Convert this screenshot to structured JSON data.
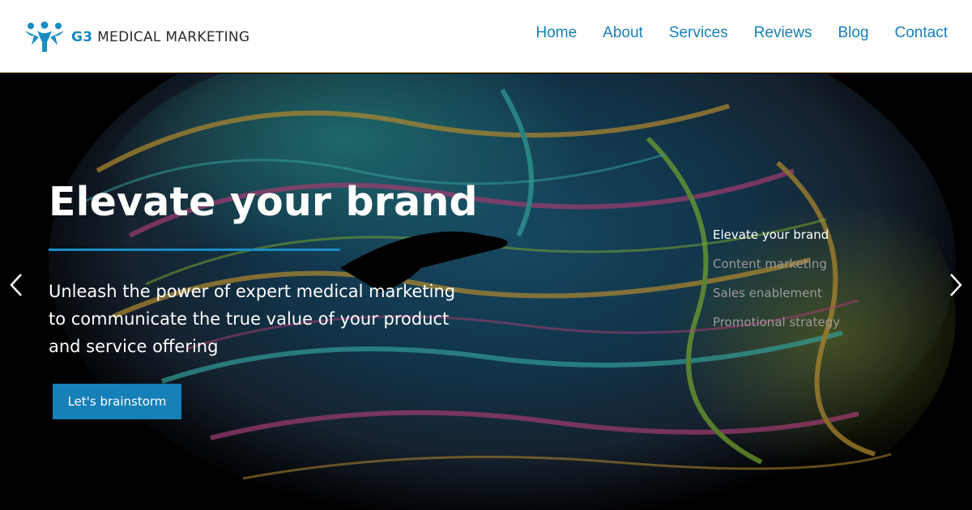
{
  "brand": {
    "name_prefix": "G3",
    "name_rest": " MEDICAL MARKETING",
    "logo_icon": "people-group-icon",
    "colors": {
      "accent": "#1680b8",
      "header_border": "#c9a74a"
    }
  },
  "nav": {
    "items": [
      {
        "label": "Home"
      },
      {
        "label": "About"
      },
      {
        "label": "Services"
      },
      {
        "label": "Reviews"
      },
      {
        "label": "Blog"
      },
      {
        "label": "Contact"
      }
    ]
  },
  "hero": {
    "title": "Elevate your brand",
    "subtitle": "Unleash the power of expert medical marketing to communicate the true value of your product and service offering",
    "cta_label": "Let's brainstorm",
    "background": "brain-scan-image",
    "slides": [
      {
        "label": "Elevate your brand",
        "active": true
      },
      {
        "label": "Content marketing",
        "active": false
      },
      {
        "label": "Sales enablement",
        "active": false
      },
      {
        "label": "Promotional strategy",
        "active": false
      }
    ],
    "prev_icon": "chevron-left-icon",
    "next_icon": "chevron-right-icon"
  }
}
